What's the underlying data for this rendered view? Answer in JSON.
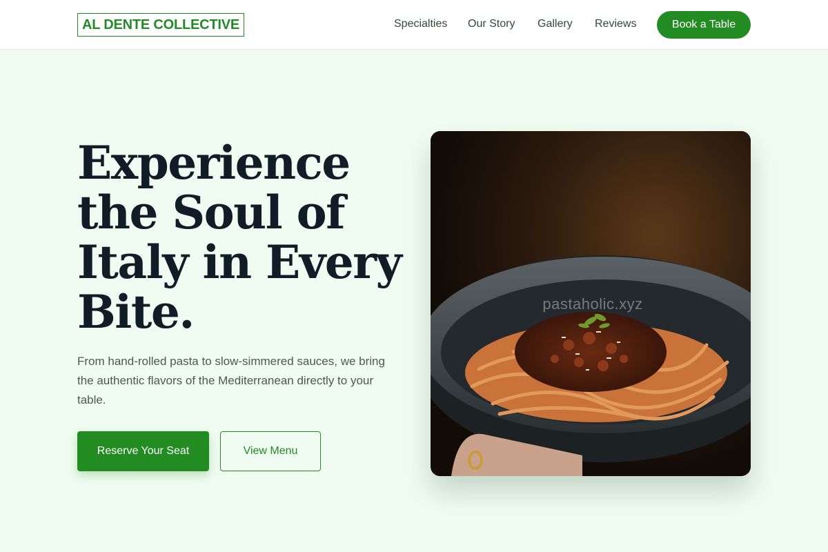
{
  "brand": {
    "logo_text": "AL DENTE COLLECTIVE",
    "accent_color": "#228b22"
  },
  "nav": {
    "items": [
      {
        "label": "Specialties"
      },
      {
        "label": "Our Story"
      },
      {
        "label": "Gallery"
      },
      {
        "label": "Reviews"
      }
    ],
    "cta_label": "Book a Table"
  },
  "hero": {
    "headline": "Experience the Soul of Italy in Every Bite.",
    "lead": "From hand-rolled pasta to slow-simmered sauces, we bring the authentic flavors of the Mediterranean directly to your table.",
    "primary_button": "Reserve Your Seat",
    "secondary_button": "View Menu"
  },
  "image": {
    "subject": "bowl-of-spaghetti-bolognese-photo",
    "watermark": "pastaholic.xyz"
  }
}
